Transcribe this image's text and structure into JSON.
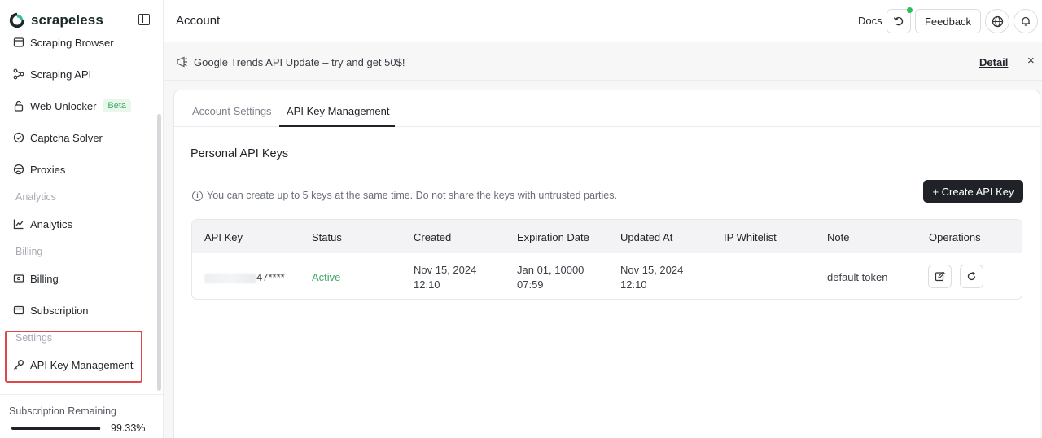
{
  "brand": {
    "name": "scrapeless"
  },
  "sidebar": {
    "items": [
      {
        "label": "Scraping Browser",
        "icon": "browser-icon"
      },
      {
        "label": "Scraping API",
        "icon": "api-icon"
      },
      {
        "label": "Web Unlocker",
        "icon": "unlock-icon",
        "badge": "Beta"
      },
      {
        "label": "Captcha Solver",
        "icon": "check-circle-icon"
      },
      {
        "label": "Proxies",
        "icon": "globe-icon"
      },
      {
        "label": "Analytics",
        "icon": "analytics-icon"
      },
      {
        "label": "Billing",
        "icon": "billing-icon"
      },
      {
        "label": "Subscription",
        "icon": "card-icon"
      },
      {
        "label": "API Key Management",
        "icon": "key-icon"
      }
    ],
    "sections": {
      "analytics": "Analytics",
      "billing": "Billing",
      "settings": "Settings"
    },
    "subscription": {
      "label": "Subscription Remaining",
      "percent_text": "99.33%",
      "fraction": 0.9933
    }
  },
  "header": {
    "title": "Account",
    "docs": "Docs",
    "feedback": "Feedback"
  },
  "banner": {
    "text": "Google Trends API Update – try and get 50$!",
    "detail": "Detail",
    "close": "×"
  },
  "tabs": [
    {
      "label": "Account Settings",
      "active": false
    },
    {
      "label": "API Key Management",
      "active": true
    }
  ],
  "main": {
    "section_title": "Personal API Keys",
    "info": "You can create up to 5 keys at the same time. Do not share the keys with untrusted parties.",
    "create_button": "+ Create API Key",
    "columns": [
      "API Key",
      "Status",
      "Created",
      "Expiration Date",
      "Updated At",
      "IP Whitelist",
      "Note",
      "Operations"
    ],
    "rows": [
      {
        "key_suffix": "47****",
        "status": "Active",
        "created_date": "Nov 15, 2024",
        "created_time": "12:10",
        "expiration_date": "Jan 01, 10000",
        "expiration_time": "07:59",
        "updated_date": "Nov 15, 2024",
        "updated_time": "12:10",
        "ip_whitelist": "",
        "note": "default token"
      }
    ]
  },
  "colors": {
    "accent": "#1f2328",
    "active": "#3ea864",
    "highlight": "#e0474c",
    "online_dot": "#2fbf5a"
  }
}
